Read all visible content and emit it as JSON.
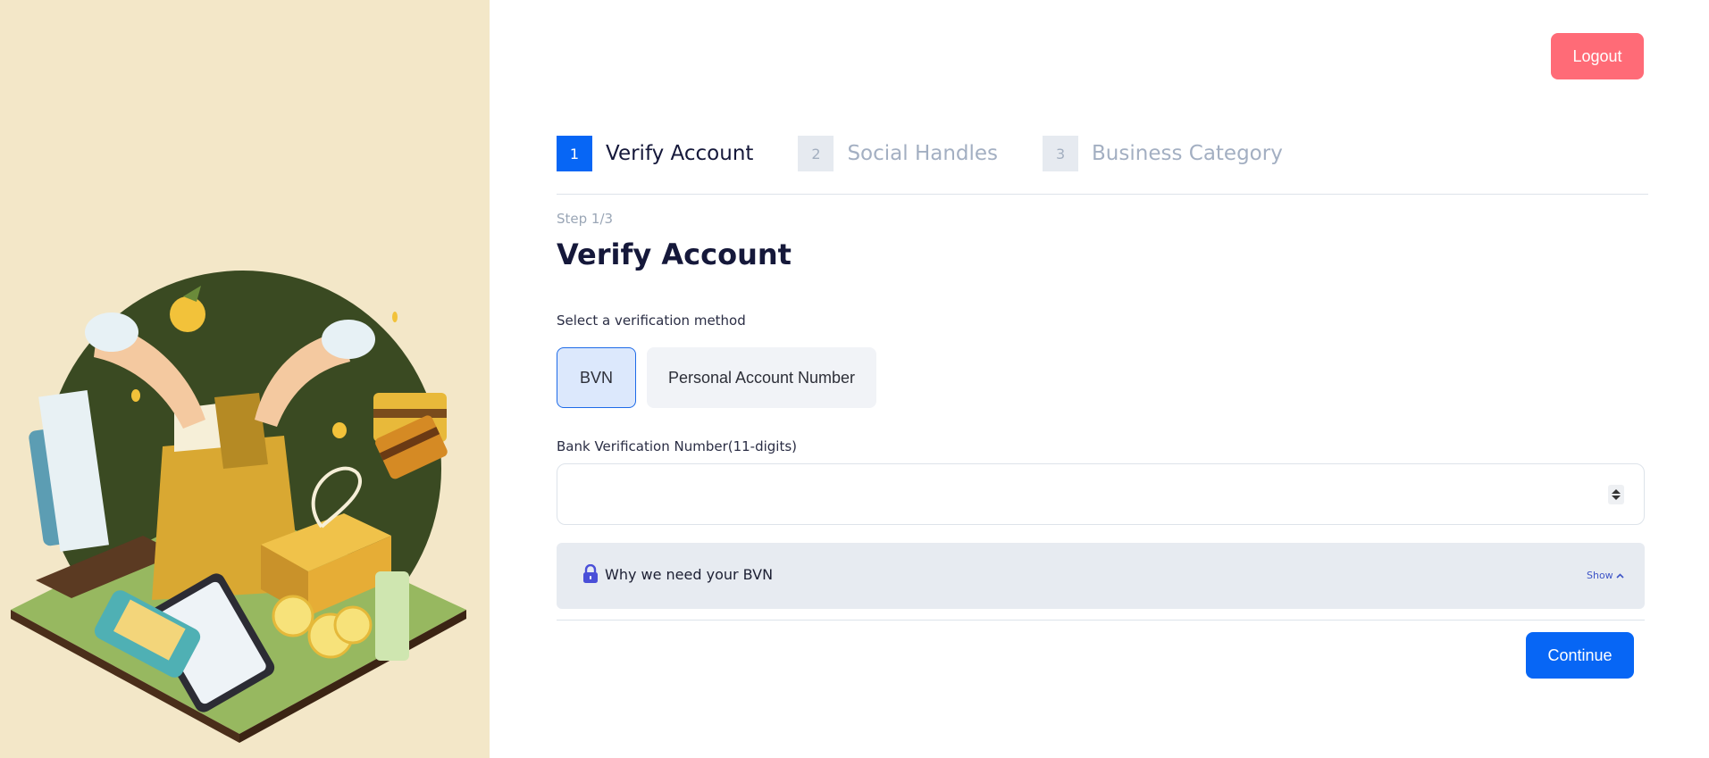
{
  "header": {
    "logout_label": "Logout"
  },
  "steps": [
    {
      "number": "1",
      "label": "Verify Account",
      "state": "active"
    },
    {
      "number": "2",
      "label": "Social Handles",
      "state": "inactive"
    },
    {
      "number": "3",
      "label": "Business Category",
      "state": "inactive"
    }
  ],
  "form": {
    "step_count": "Step 1/3",
    "title": "Verify Account",
    "method_label": "Select a verification method",
    "methods": [
      {
        "label": "BVN",
        "selected": true
      },
      {
        "label": "Personal Account Number",
        "selected": false
      }
    ],
    "bvn_label": "Bank Verification Number(11-digits)",
    "bvn_value": "",
    "info": {
      "text": "Why we need your BVN",
      "toggle_label": "Show",
      "icon": "lock-icon"
    },
    "continue_label": "Continue"
  },
  "colors": {
    "primary": "#0766f5",
    "logout": "#ff6b77",
    "left_panel_bg": "#f3e7c8",
    "info_bg": "#e7ebf1"
  }
}
